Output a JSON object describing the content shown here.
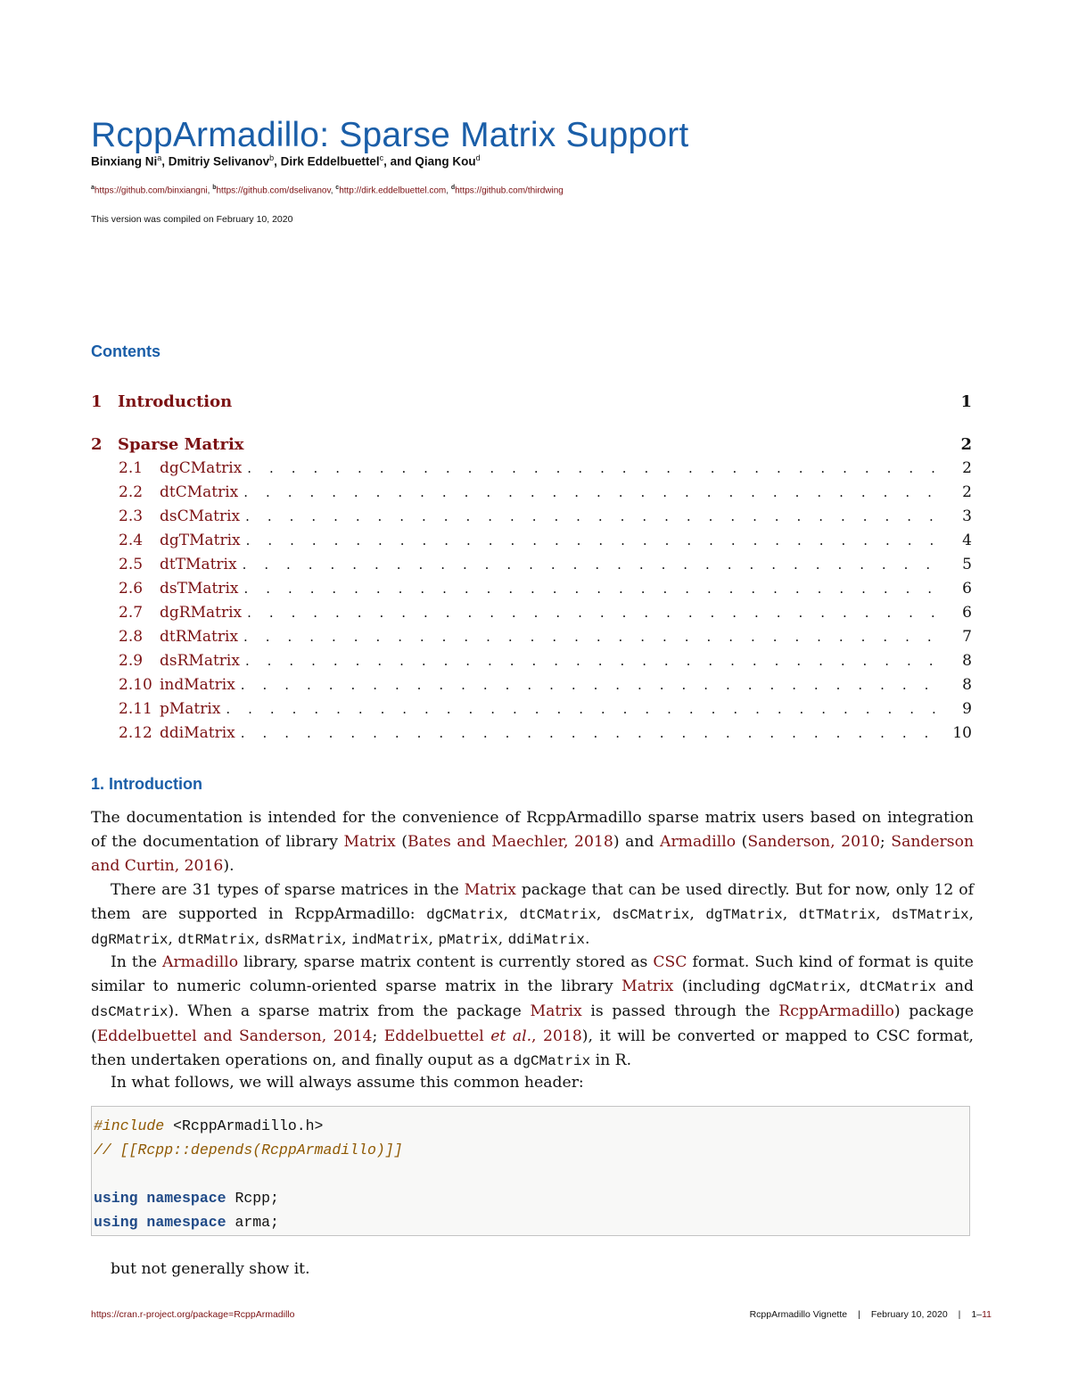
{
  "title": "RcppArmadillo: Sparse Matrix Support",
  "authors": [
    {
      "name": "Binxiang Ni",
      "mark": "a",
      "sep": ", "
    },
    {
      "name": "Dmitriy Selivanov",
      "mark": "b",
      "sep": ", "
    },
    {
      "name": "Dirk Eddelbuettel",
      "mark": "c",
      "sep": ", and "
    },
    {
      "name": "Qiang Kou",
      "mark": "d",
      "sep": ""
    }
  ],
  "affiliations": [
    {
      "mark": "a",
      "url": "https://github.com/binxiangni",
      "sep": ", "
    },
    {
      "mark": "b",
      "url": "https://github.com/dselivanov",
      "sep": ", "
    },
    {
      "mark": "c",
      "url": "http://dirk.eddelbuettel.com",
      "sep": ", "
    },
    {
      "mark": "d",
      "url": "https://github.com/thirdwing",
      "sep": ""
    }
  ],
  "compiled_note": "This version was compiled on February 10, 2020",
  "contents": {
    "heading": "Contents",
    "sections": [
      {
        "num": "1",
        "label": "Introduction",
        "page": "1"
      },
      {
        "num": "2",
        "label": "Sparse Matrix",
        "page": "2"
      }
    ],
    "subsections": [
      {
        "num": "2.1",
        "label": "dgCMatrix",
        "page": "2"
      },
      {
        "num": "2.2",
        "label": "dtCMatrix",
        "page": "2"
      },
      {
        "num": "2.3",
        "label": "dsCMatrix",
        "page": "3"
      },
      {
        "num": "2.4",
        "label": "dgTMatrix",
        "page": "4"
      },
      {
        "num": "2.5",
        "label": "dtTMatrix",
        "page": "5"
      },
      {
        "num": "2.6",
        "label": "dsTMatrix",
        "page": "6"
      },
      {
        "num": "2.7",
        "label": "dgRMatrix",
        "page": "6"
      },
      {
        "num": "2.8",
        "label": "dtRMatrix",
        "page": "7"
      },
      {
        "num": "2.9",
        "label": "dsRMatrix",
        "page": "8"
      },
      {
        "num": "2.10",
        "label": "indMatrix",
        "page": "8"
      },
      {
        "num": "2.11",
        "label": "pMatrix",
        "page": "9"
      },
      {
        "num": "2.12",
        "label": "ddiMatrix",
        "page": "10"
      }
    ],
    "dots": ". . . . . . . . . . . . . . . . . . . . . . . . . . . . . . . . . . . . . . . . . . . . . . . . . . . . . . . . . . . . . . . . . . . ."
  },
  "intro": {
    "heading": "1. Introduction",
    "p1": [
      {
        "t": "The documentation is intended for the convenience of RcppArmadillo sparse matrix users based on integration of the documentation of library "
      },
      {
        "t": "Matrix",
        "link": true
      },
      {
        "t": " ("
      },
      {
        "t": "Bates and Maechler, 2018",
        "link": true
      },
      {
        "t": ") and "
      },
      {
        "t": "Armadillo",
        "link": true
      },
      {
        "t": " ("
      },
      {
        "t": "Sanderson, 2010",
        "link": true
      },
      {
        "t": "; "
      },
      {
        "t": "Sanderson and Curtin, 2016",
        "link": true
      },
      {
        "t": ")."
      }
    ],
    "p2": [
      {
        "t": "There are 31 types of sparse matrices in the "
      },
      {
        "t": "Matrix",
        "link": true
      },
      {
        "t": " package that can be used directly. But for now, only 12 of them are supported in RcppArmadillo: "
      },
      {
        "t": "dgCMatrix",
        "code": true
      },
      {
        "t": ", "
      },
      {
        "t": "dtCMatrix",
        "code": true
      },
      {
        "t": ", "
      },
      {
        "t": "dsCMatrix",
        "code": true
      },
      {
        "t": ", "
      },
      {
        "t": "dgTMatrix",
        "code": true
      },
      {
        "t": ", "
      },
      {
        "t": "dtTMatrix",
        "code": true
      },
      {
        "t": ", "
      },
      {
        "t": "dsTMatrix",
        "code": true
      },
      {
        "t": ", "
      },
      {
        "t": "dgRMatrix",
        "code": true
      },
      {
        "t": ", "
      },
      {
        "t": "dtRMatrix",
        "code": true
      },
      {
        "t": ", "
      },
      {
        "t": "dsRMatrix",
        "code": true
      },
      {
        "t": ", "
      },
      {
        "t": "indMatrix",
        "code": true
      },
      {
        "t": ", "
      },
      {
        "t": "pMatrix",
        "code": true
      },
      {
        "t": ", "
      },
      {
        "t": "ddiMatrix",
        "code": true
      },
      {
        "t": "."
      }
    ],
    "p3": [
      {
        "t": "In the "
      },
      {
        "t": "Armadillo",
        "link": true
      },
      {
        "t": " library, sparse matrix content is currently stored as "
      },
      {
        "t": "CSC",
        "link": true
      },
      {
        "t": " format. Such kind of format is quite similar to numeric column-oriented sparse matrix in the library "
      },
      {
        "t": "Matrix",
        "link": true
      },
      {
        "t": " (including "
      },
      {
        "t": "dgCMatrix",
        "code": true
      },
      {
        "t": ", "
      },
      {
        "t": "dtCMatrix",
        "code": true
      },
      {
        "t": " and "
      },
      {
        "t": "dsCMatrix",
        "code": true
      },
      {
        "t": "). When a sparse matrix from the package "
      },
      {
        "t": "Matrix",
        "link": true
      },
      {
        "t": " is passed through the "
      },
      {
        "t": "RcppArmadillo",
        "link": true
      },
      {
        "t": ") package ("
      },
      {
        "t": "Eddelbuettel and Sanderson, 2014",
        "link": true
      },
      {
        "t": "; "
      },
      {
        "t": "Eddelbuettel ",
        "link": true
      },
      {
        "t": "et al.",
        "link": true,
        "italic": true
      },
      {
        "t": ", 2018",
        "link": true
      },
      {
        "t": "), it will be converted or mapped to CSC format, then undertaken operations on, and finally ouput as a "
      },
      {
        "t": "dgCMatrix",
        "code": true
      },
      {
        "t": " in R."
      }
    ],
    "p4": "In what follows, we will always assume this common header:",
    "code": [
      [
        {
          "t": "#include",
          "cls": "c-pre"
        },
        {
          "t": " <RcppArmadillo.h>",
          "cls": "c-plain"
        }
      ],
      [
        {
          "t": "// [[Rcpp::depends(RcppArmadillo)]]",
          "cls": "c-comment"
        }
      ],
      [],
      [
        {
          "t": "using",
          "cls": "c-kw"
        },
        {
          "t": " ",
          "cls": "c-plain"
        },
        {
          "t": "namespace",
          "cls": "c-kw"
        },
        {
          "t": " Rcpp;",
          "cls": "c-plain"
        }
      ],
      [
        {
          "t": "using",
          "cls": "c-kw"
        },
        {
          "t": " ",
          "cls": "c-plain"
        },
        {
          "t": "namespace",
          "cls": "c-kw"
        },
        {
          "t": " arma;",
          "cls": "c-plain"
        }
      ]
    ],
    "closing": "but not generally show it."
  },
  "footer": {
    "url": "https://cran.r-project.org/package=RcppArmadillo",
    "vignette": "RcppArmadillo Vignette",
    "date": "February 10, 2020",
    "page_prefix": "1–",
    "page_total": "11",
    "separator": "|"
  },
  "colors": {
    "heading_blue": "#1a5ea8",
    "link_red": "#7b1113",
    "code_bg": "#f8f8f7"
  }
}
